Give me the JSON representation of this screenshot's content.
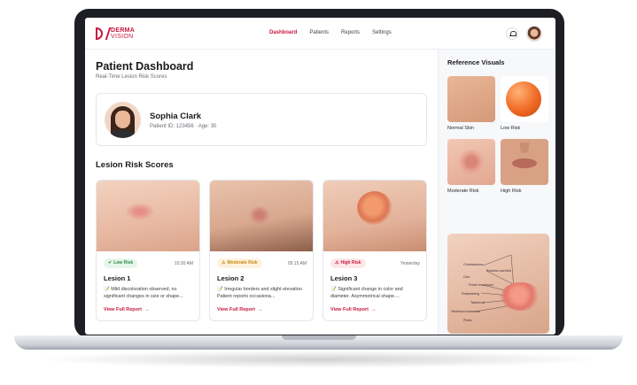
{
  "brand": {
    "name_top": "DERMA",
    "name_bottom": "VISION",
    "accent": "#c8183f"
  },
  "nav": {
    "items": [
      "Dashboard",
      "Patients",
      "Reports",
      "Settings"
    ],
    "active": "Dashboard"
  },
  "header": {
    "bell_icon": "bell-icon"
  },
  "page": {
    "title": "Patient Dashboard",
    "subtitle": "Real-Time Lesion Risk Scores"
  },
  "patient": {
    "name": "Sophia Clark",
    "meta": "Patient ID: 123456  ·  Age: 30"
  },
  "lesions_section": {
    "title": "Lesion Risk Scores"
  },
  "lesions": [
    {
      "badge": "Low Risk",
      "badge_icon": "✔",
      "time": "10:30 AM",
      "name": "Lesion 1",
      "desc": "📝 Mild discoloration observed, no significant changes in size or shape...",
      "report": "View Full Report",
      "arrow": "→"
    },
    {
      "badge": "Moderate Risk",
      "badge_icon": "⚠",
      "time": "05:15 AM",
      "name": "Lesion 2",
      "desc": "📝 Irregular borders and slight elevation. Patient reports occasiona...",
      "report": "View Full Report",
      "arrow": "→"
    },
    {
      "badge": "High Risk",
      "badge_icon": "⚠",
      "time": "Yesterday",
      "name": "Lesion 3",
      "desc": "📝 Significant change in color and diameter. Asymmetrical shape....",
      "report": "View Full Report",
      "arrow": "→"
    }
  ],
  "reference": {
    "title": "Reference Visuals",
    "items": [
      "Normal Skin",
      "Low Risk",
      "Moderate Risk",
      "High Risk"
    ],
    "diagram_labels": [
      "Cholestatoma",
      "Raoteas wachtivs",
      "Cioo",
      "Pooke leactaroon",
      "Rottambving",
      "Taaelerud",
      "Neobhood autowack",
      "Pistes"
    ]
  }
}
